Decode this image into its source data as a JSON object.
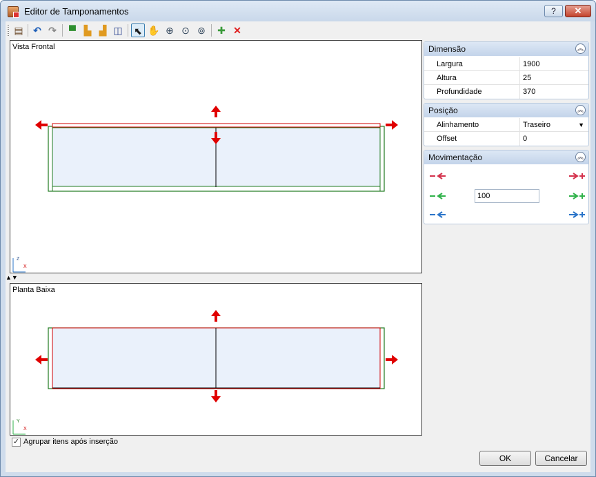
{
  "window": {
    "title": "Editor de Tamponamentos",
    "help_label": "?",
    "close_label": "✕"
  },
  "toolbar": {
    "buttons": [
      {
        "name": "properties-icon",
        "glyph": "▤"
      },
      {
        "name": "undo-icon",
        "glyph": "↶"
      },
      {
        "name": "redo-icon",
        "glyph": "↷"
      },
      {
        "name": "align-top-icon",
        "glyph": "▀"
      },
      {
        "name": "align-left-icon",
        "glyph": "▙"
      },
      {
        "name": "align-right-icon",
        "glyph": "▟"
      },
      {
        "name": "split-icon",
        "glyph": "◫"
      },
      {
        "name": "select-pointer-icon",
        "glyph": "⬉"
      },
      {
        "name": "pan-hand-icon",
        "glyph": "✋"
      },
      {
        "name": "zoom-in-icon",
        "glyph": "⊕"
      },
      {
        "name": "zoom-window-icon",
        "glyph": "⊙"
      },
      {
        "name": "zoom-extents-icon",
        "glyph": "⊚"
      },
      {
        "name": "insert-icon",
        "glyph": "✚"
      },
      {
        "name": "delete-icon",
        "glyph": "✕"
      }
    ]
  },
  "views": {
    "front": {
      "label": "Vista Frontal",
      "axis_v": "Z",
      "axis_h": "X"
    },
    "top": {
      "label": "Planta Baixa",
      "axis_v": "Y",
      "axis_h": "X"
    }
  },
  "splitter": {
    "glyph": "▲▼"
  },
  "dimensao": {
    "title": "Dimensão",
    "rows": [
      {
        "label": "Largura",
        "value": "1900"
      },
      {
        "label": "Altura",
        "value": "25"
      },
      {
        "label": "Profundidade",
        "value": "370"
      }
    ]
  },
  "posicao": {
    "title": "Posição",
    "rows": [
      {
        "label": "Alinhamento",
        "value": "Traseiro"
      },
      {
        "label": "Offset",
        "value": "0"
      }
    ]
  },
  "movimentacao": {
    "title": "Movimentação",
    "step_value": "100"
  },
  "options": {
    "group_items_label": "Agrupar itens após inserção",
    "group_items_checked": true
  },
  "dialog": {
    "ok_label": "OK",
    "cancel_label": "Cancelar"
  },
  "colors": {
    "accent_red": "#e00000",
    "outline_green": "#1f7a1f",
    "fill_light_blue": "#eaf1fb",
    "move_x": "#d4314c",
    "move_y": "#2fb24a",
    "move_z": "#2a74c9"
  }
}
